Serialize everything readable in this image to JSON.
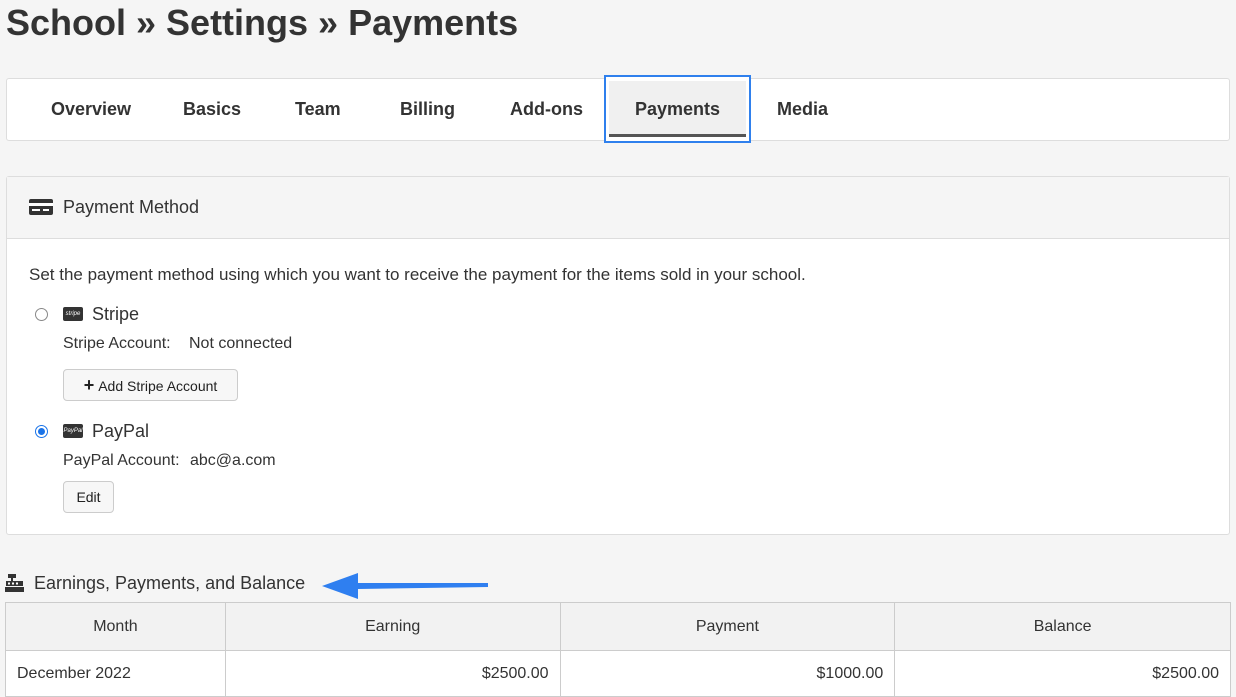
{
  "header": {
    "title": "School » Settings » Payments"
  },
  "tabs": [
    {
      "label": "Overview",
      "active": false
    },
    {
      "label": "Basics",
      "active": false
    },
    {
      "label": "Team",
      "active": false
    },
    {
      "label": "Billing",
      "active": false
    },
    {
      "label": "Add-ons",
      "active": false
    },
    {
      "label": "Payments",
      "active": true
    },
    {
      "label": "Media",
      "active": false
    }
  ],
  "payment_method": {
    "title": "Payment Method",
    "intro": "Set the payment method using which you want to receive the payment for the items sold in your school.",
    "stripe": {
      "name": "Stripe",
      "icon_text": "stripe",
      "account_label": "Stripe Account:",
      "account_value": "Not connected",
      "button_label": "Add Stripe Account",
      "selected": false
    },
    "paypal": {
      "name": "PayPal",
      "icon_text": "PayPal",
      "account_label": "PayPal Account:",
      "account_value": "abc@a.com",
      "button_label": "Edit",
      "selected": true
    }
  },
  "earnings": {
    "title": "Earnings, Payments, and Balance",
    "columns": [
      "Month",
      "Earning",
      "Payment",
      "Balance"
    ],
    "rows": [
      {
        "month": "December 2022",
        "earning": "$2500.00",
        "payment": "$1000.00",
        "balance": "$2500.00"
      }
    ]
  },
  "colors": {
    "accent": "#2f80ed",
    "arrow": "#2f7ff0"
  }
}
